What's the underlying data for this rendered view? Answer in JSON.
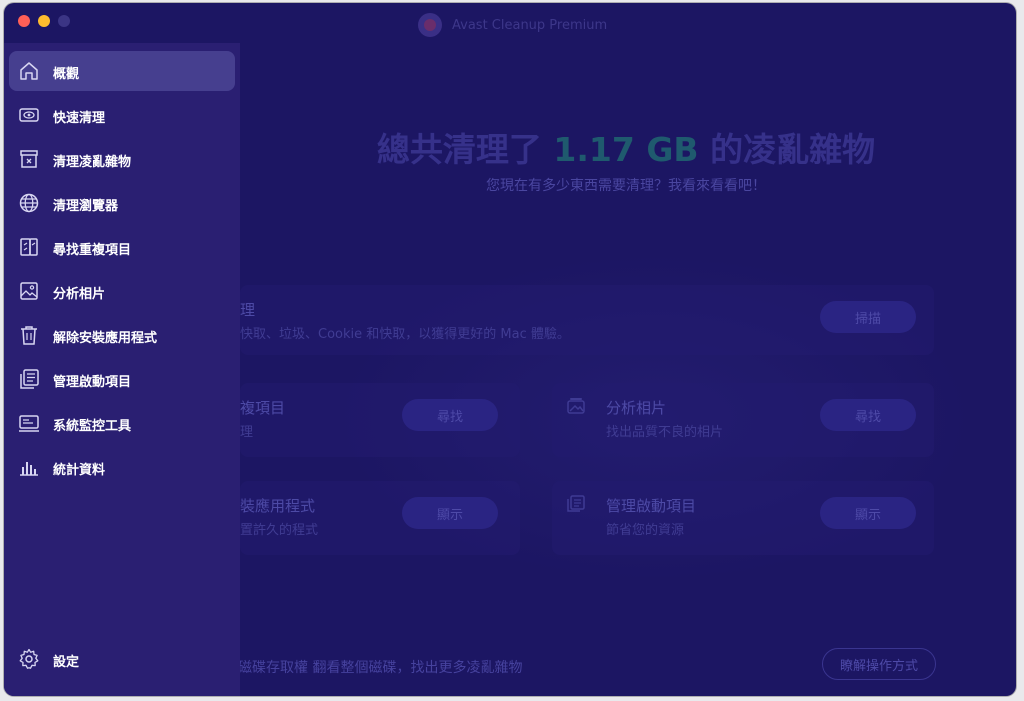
{
  "window": {
    "title": "Avast Cleanup Premium"
  },
  "main": {
    "headline_prefix": "總共清理了",
    "headline_amount": "1.17 GB",
    "headline_suffix": "的凌亂雜物",
    "subtitle": "您現在有多少東西需要清理？我看來看看吧！",
    "cards": {
      "quick_clean": {
        "title_fragment": "理",
        "desc_fragment": "快取、垃圾、Cookie 和快取，以獲得更好的 Mac 體驗。",
        "button": "掃描"
      },
      "duplicates": {
        "title_fragment": "複項目",
        "desc_fragment": "理",
        "button": "尋找"
      },
      "photos": {
        "title": "分析相片",
        "desc": "找出品質不良的相片",
        "button": "尋找"
      },
      "uninstall": {
        "title_fragment": "裝應用程式",
        "desc_fragment": "置許久的程式",
        "button": "顯示"
      },
      "startup": {
        "title": "管理啟動項目",
        "desc": "節省您的資源",
        "button": "顯示"
      }
    },
    "footer_text": "磁碟存取權 翻看整個磁碟，找出更多凌亂雜物",
    "footer_button": "瞭解操作方式"
  },
  "sidebar": {
    "items": [
      {
        "label": "概觀",
        "icon": "home-icon"
      },
      {
        "label": "快速清理",
        "icon": "eye-icon"
      },
      {
        "label": "清理凌亂雜物",
        "icon": "junk-box-icon"
      },
      {
        "label": "清理瀏覽器",
        "icon": "globe-icon"
      },
      {
        "label": "尋找重複項目",
        "icon": "duplicates-icon"
      },
      {
        "label": "分析相片",
        "icon": "photo-icon"
      },
      {
        "label": "解除安裝應用程式",
        "icon": "trash-icon"
      },
      {
        "label": "管理啟動項目",
        "icon": "startup-items-icon"
      },
      {
        "label": "系統監控工具",
        "icon": "monitor-icon"
      },
      {
        "label": "統計資料",
        "icon": "bar-chart-icon"
      }
    ],
    "settings_label": "設定",
    "settings_icon": "gear-icon",
    "active_index": 0
  },
  "colors": {
    "background": "#1c1663",
    "sidebar": "#2a1f72",
    "active_item": "#463f8f",
    "accent_amount": "#1f5a6e"
  }
}
